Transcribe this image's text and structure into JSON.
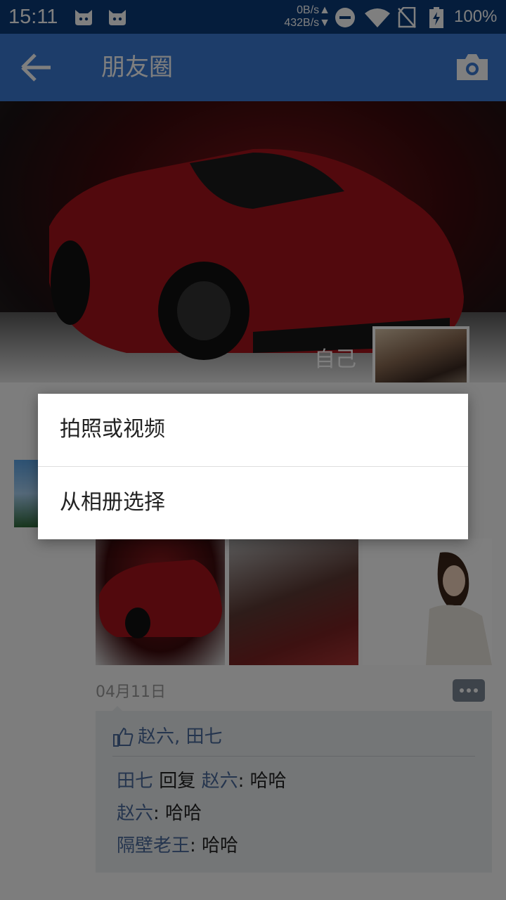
{
  "status_bar": {
    "time": "15:11",
    "net_up": "0B/s▲",
    "net_down": "432B/s▼",
    "battery": "100%",
    "icons": [
      "app-notification-icon",
      "app-notification-icon",
      "do-not-disturb-icon",
      "wifi-icon",
      "no-sim-icon",
      "battery-charging-icon"
    ]
  },
  "app_bar": {
    "title": "朋友圈",
    "back_icon": "arrow-left-icon",
    "camera_icon": "camera-icon"
  },
  "cover": {
    "name": "自己"
  },
  "post": {
    "date": "04月11日",
    "likes": "赵六, 田七",
    "comments": [
      {
        "name": "田七",
        "reply_word": "回复",
        "reply_to": "赵六",
        "sep": ": ",
        "text": "哈哈"
      },
      {
        "name": "赵六",
        "sep": ": ",
        "text": "哈哈"
      },
      {
        "name": "隔壁老王",
        "sep": ": ",
        "text": "哈哈"
      }
    ]
  },
  "dialog": {
    "options": [
      "拍照或视频",
      "从相册选择"
    ]
  },
  "colors": {
    "status_bar": "#0a3a78",
    "app_bar": "#3a7bd5",
    "link_name": "#4a6a9c"
  }
}
